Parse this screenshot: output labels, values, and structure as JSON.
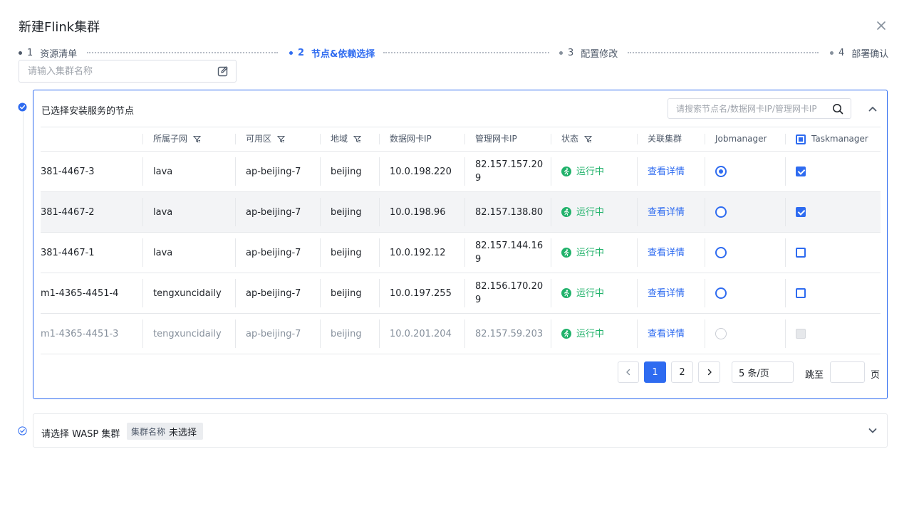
{
  "dialog": {
    "title": "新建Flink集群"
  },
  "steps": [
    {
      "num": "1",
      "label": "资源清单"
    },
    {
      "num": "2",
      "label": "节点&依赖选择"
    },
    {
      "num": "3",
      "label": "配置修改"
    },
    {
      "num": "4",
      "label": "部署确认"
    }
  ],
  "cluster_name": {
    "placeholder": "请输入集群名称",
    "value": ""
  },
  "nodes_panel": {
    "title": "已选择安装服务的节点",
    "search_placeholder": "请搜索节点名/数据网卡IP/管理网卡IP",
    "columns": [
      "",
      "所属子网",
      "可用区",
      "地域",
      "数据网卡IP",
      "管理网卡IP",
      "状态",
      "关联集群",
      "Jobmanager",
      "Taskmanager"
    ],
    "rows": [
      {
        "name": "381-4467-3",
        "subnet": "lava",
        "zone": "ap-beijing-7",
        "region": "beijing",
        "data_ip": "10.0.198.220",
        "mgmt_ip": "82.157.157.209",
        "status": "运行中",
        "cluster": "查看详情"
      },
      {
        "name": "381-4467-2",
        "subnet": "lava",
        "zone": "ap-beijing-7",
        "region": "beijing",
        "data_ip": "10.0.198.96",
        "mgmt_ip": "82.157.138.80",
        "status": "运行中",
        "cluster": "查看详情"
      },
      {
        "name": "381-4467-1",
        "subnet": "lava",
        "zone": "ap-beijing-7",
        "region": "beijing",
        "data_ip": "10.0.192.12",
        "mgmt_ip": "82.157.144.169",
        "status": "运行中",
        "cluster": "查看详情"
      },
      {
        "name": "m1-4365-4451-4",
        "subnet": "tengxuncidaily",
        "zone": "ap-beijing-7",
        "region": "beijing",
        "data_ip": "10.0.197.255",
        "mgmt_ip": "82.156.170.209",
        "status": "运行中",
        "cluster": "查看详情"
      },
      {
        "name": "m1-4365-4451-3",
        "subnet": "tengxuncidaily",
        "zone": "ap-beijing-7",
        "region": "beijing",
        "data_ip": "10.0.201.204",
        "mgmt_ip": "82.157.59.203",
        "status": "运行中",
        "cluster": "查看详情"
      }
    ],
    "pagination": {
      "pages": [
        "1",
        "2"
      ],
      "page_size": "5 条/页",
      "jump_label": "跳至",
      "jump_suffix": "页",
      "jump_value": ""
    }
  },
  "wasp_panel": {
    "title": "请选择 WASP 集群",
    "tag_key": "集群名称",
    "tag_value": "未选择"
  },
  "colors": {
    "primary": "#2e6bf0",
    "success": "#21b26b",
    "border": "#e6e8eb"
  }
}
